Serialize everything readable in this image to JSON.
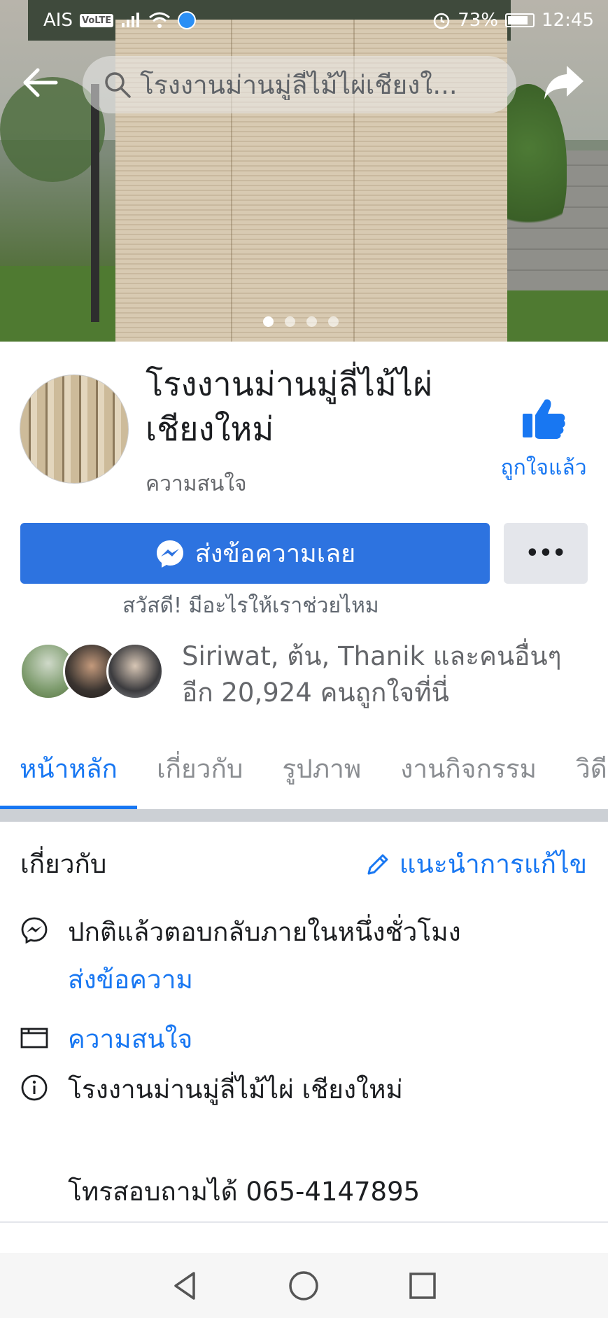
{
  "status_bar": {
    "carrier": "AIS",
    "volte": "VoLTE",
    "battery": "73%",
    "time": "12:45",
    "battery_level": 0.73
  },
  "header": {
    "search_text": "โรงงานม่านมู่ลี่ไม้ไผ่เชียงใ...",
    "back_icon": "back-arrow-icon",
    "share_icon": "share-arrow-icon"
  },
  "cover": {
    "photo_count": 4,
    "active_index": 0
  },
  "profile": {
    "name": "โรงงานม่านมู่ลี่ไม้ไผ่ เชียงใหม่",
    "category": "ความสนใจ",
    "like_label": "ถูกใจแล้ว"
  },
  "actions": {
    "message_label": "ส่งข้อความเลย",
    "more_label": "•••",
    "greeting": "สวัสดี! มีอะไรให้เราช่วยไหม"
  },
  "social": {
    "friends_text": "Siriwat, ต้น, Thanik และคนอื่นๆ อีก 20,924 คนถูกใจที่นี่"
  },
  "tabs": [
    {
      "label": "หน้าหลัก",
      "active": true
    },
    {
      "label": "เกี่ยวกับ",
      "active": false
    },
    {
      "label": "รูปภาพ",
      "active": false
    },
    {
      "label": "งานกิจกรรม",
      "active": false
    },
    {
      "label": "วิดี",
      "active": false
    }
  ],
  "about": {
    "title": "เกี่ยวกับ",
    "suggest_edit": "แนะนำการแก้ไข",
    "response_time": "ปกติแล้วตอบกลับภายในหนึ่งชั่วโมง",
    "send_message": "ส่งข้อความ",
    "category_link": "ความสนใจ",
    "description": "โรงงานม่านมู่ลี่ไม้ไผ่  เชียงใหม่",
    "phone": "โทรสอบถามได้ 065-4147895"
  },
  "colors": {
    "facebook_blue": "#1877f2",
    "button_blue": "#2d73e0",
    "gray_text": "#65676b"
  }
}
